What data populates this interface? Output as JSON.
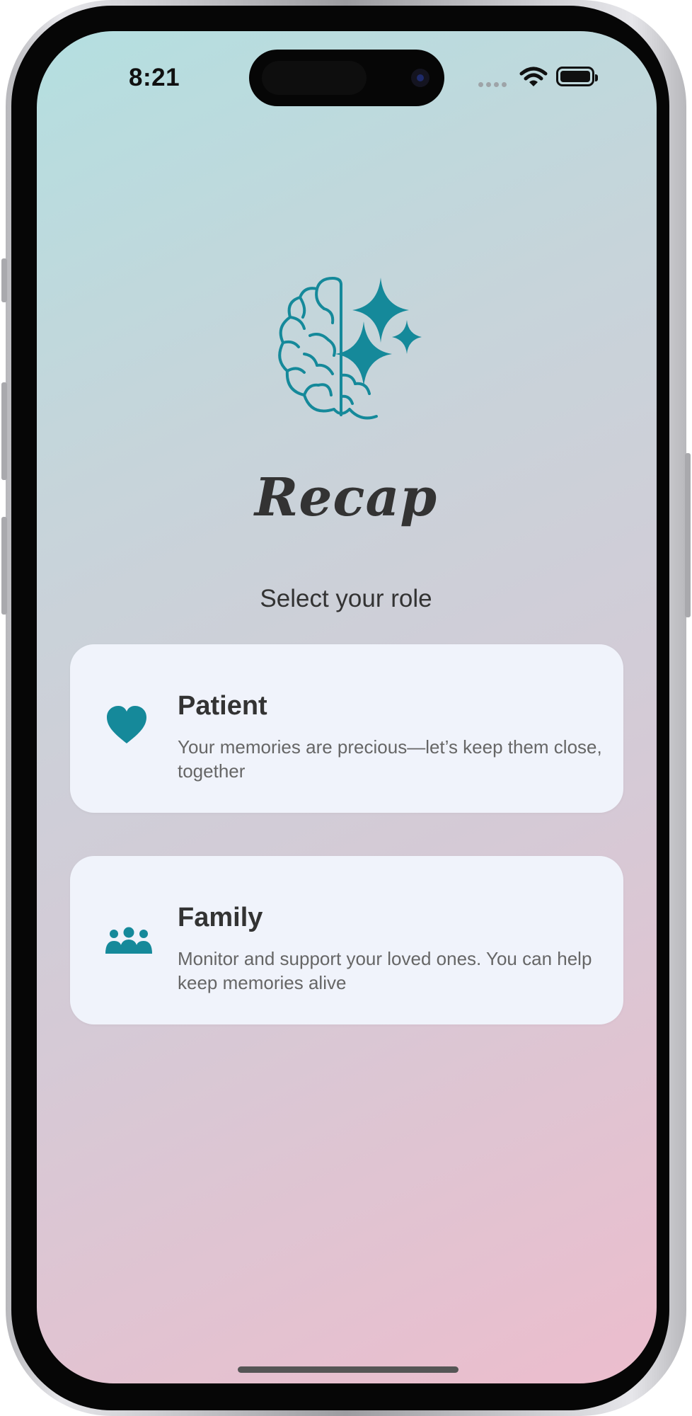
{
  "status_bar": {
    "time": "8:21",
    "icons": [
      "signal-dots-icon",
      "wifi-icon",
      "battery-icon"
    ]
  },
  "app": {
    "logo_icon": "brain-sparkles-icon",
    "name": "Recap",
    "prompt": "Select your role"
  },
  "roles": [
    {
      "icon": "heart-icon",
      "title": "Patient",
      "description": "Your memories are precious—let’s keep them close, together"
    },
    {
      "icon": "group-icon",
      "title": "Family",
      "description": "Monitor and support your loved ones. You can help keep memories alive"
    }
  ],
  "colors": {
    "accent": "#15899a",
    "text_primary": "#333333",
    "text_secondary": "#666666",
    "card_background": "#f0f3fb",
    "gradient_start": "#b4dfe0",
    "gradient_end": "#ecbdcd"
  }
}
